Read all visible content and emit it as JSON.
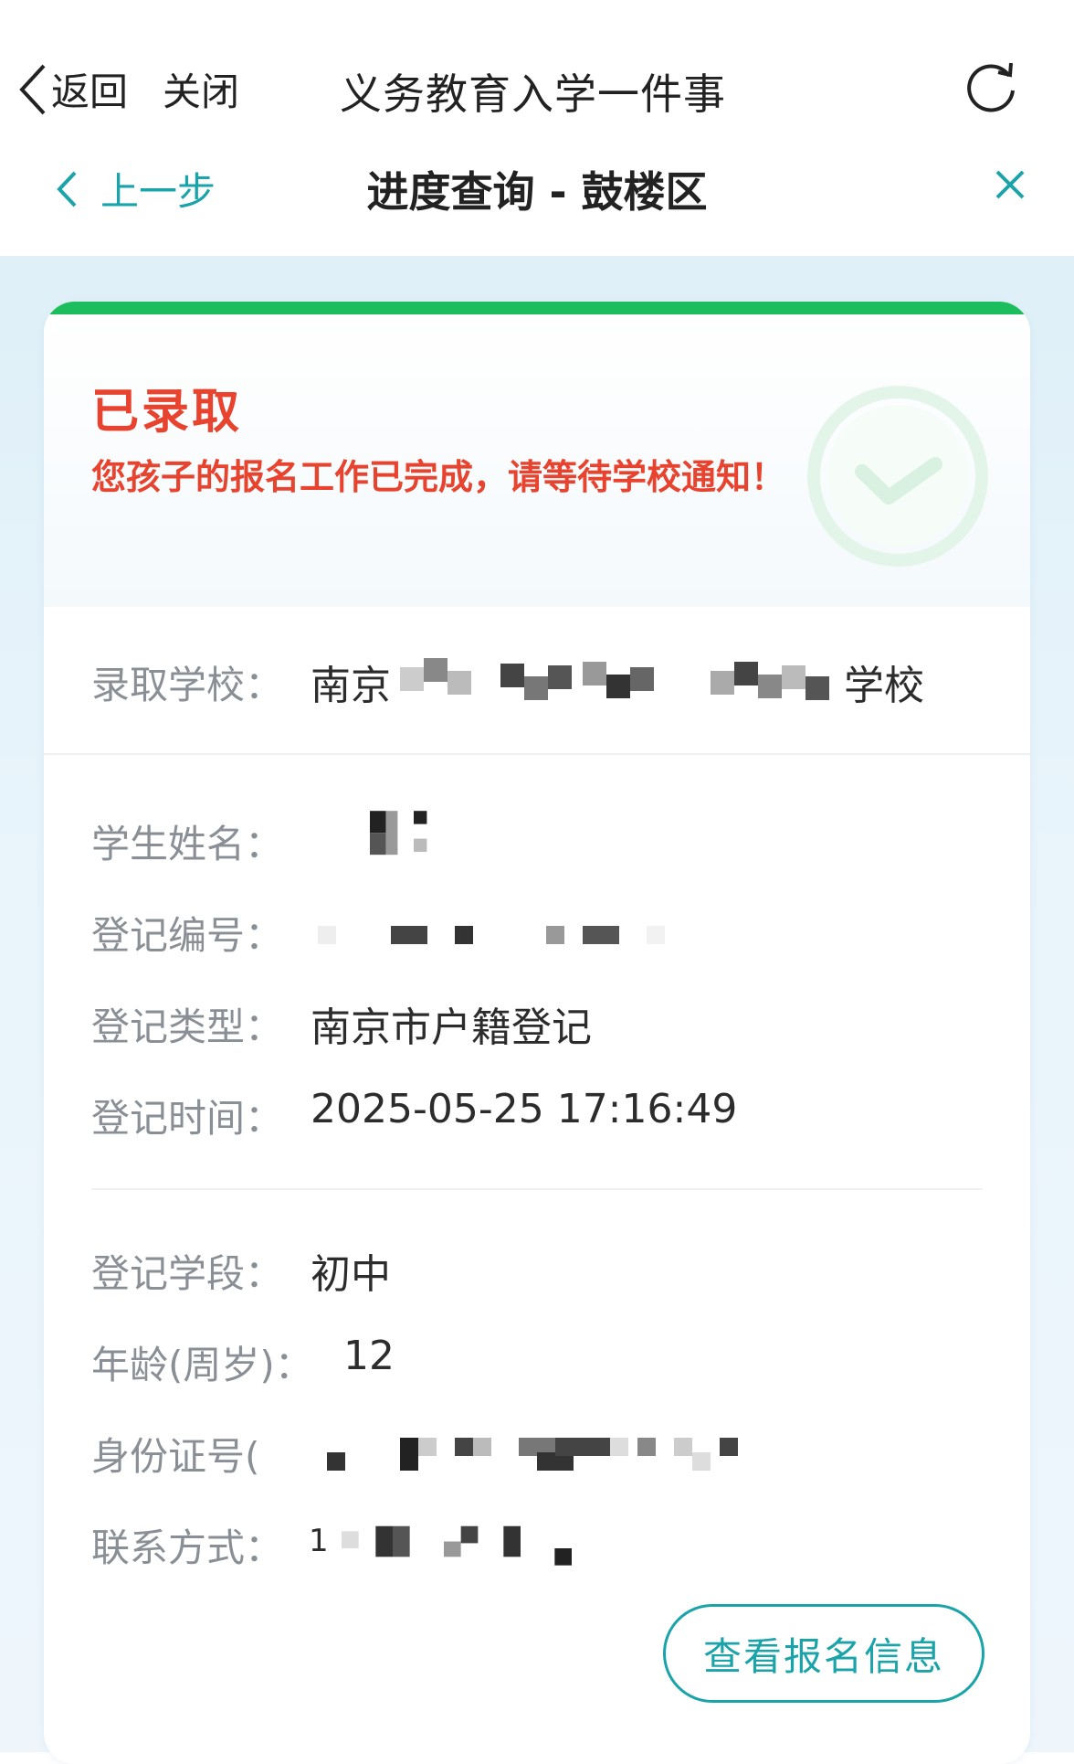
{
  "nav": {
    "back_label": "返回",
    "close_label": "关闭",
    "app_title": "义务教育入学一件事",
    "prev_label": "上一步",
    "page_title": "进度查询 - 鼓楼区"
  },
  "status": {
    "title": "已录取",
    "message": "您孩子的报名工作已完成，请等待学校通知！"
  },
  "school": {
    "label": "录取学校：",
    "value_prefix": "南京",
    "value_suffix": "学校"
  },
  "fields": {
    "student_name_label": "学生姓名：",
    "reg_number_label": "登记编号：",
    "reg_type_label": "登记类型：",
    "reg_type_value": "南京市户籍登记",
    "reg_time_label": "登记时间：",
    "reg_time_value": "2025-05-25 17:16:49",
    "stage_label": "登记学段：",
    "stage_value": "初中",
    "age_label": "年龄(周岁)：",
    "age_value": "12",
    "id_label": "身份证号(",
    "contact_label": "联系方式：",
    "contact_prefix": "1"
  },
  "actions": {
    "view_info_label": "查看报名信息"
  },
  "colors": {
    "accent": "#1aa3a8",
    "success_green": "#1cbd5c",
    "alert_red": "#e8432e"
  },
  "icons": {
    "back": "chevron-left-icon",
    "refresh": "refresh-icon",
    "prev": "chevron-left-icon",
    "close": "close-x-icon",
    "status": "check-circle-icon"
  }
}
